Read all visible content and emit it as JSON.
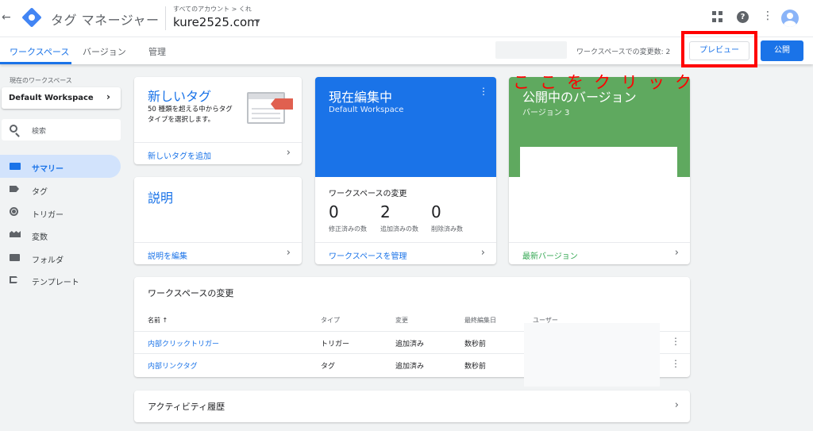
{
  "header": {
    "back_icon": "←",
    "app_title": "タグ マネージャー",
    "account_breadcrumb": "すべてのアカウント > くれ",
    "container_name": "kure2525.com",
    "caret": "▾",
    "help_glyph": "?",
    "more_glyph": "⋮"
  },
  "tabs": {
    "workspace": "ワークスペース",
    "versions": "バージョン",
    "admin": "管理"
  },
  "toolbar": {
    "changes_count": "ワークスペースでの変更数: 2",
    "preview_label": "プレビュー",
    "publish_label": "公開"
  },
  "annotation": {
    "click_here": "ここをクリック",
    "highlight_color": "#ff0000"
  },
  "sidebar": {
    "current_ws_label": "現在のワークスペース",
    "workspace_name": "Default Workspace",
    "workspace_chevron": "›",
    "search_placeholder": "検索",
    "items": [
      {
        "label": "サマリー",
        "icon": "summary-icon",
        "active": true
      },
      {
        "label": "タグ",
        "icon": "tag-icon"
      },
      {
        "label": "トリガー",
        "icon": "trigger-icon"
      },
      {
        "label": "変数",
        "icon": "variables-icon"
      },
      {
        "label": "フォルダ",
        "icon": "folder-icon"
      },
      {
        "label": "テンプレート",
        "icon": "template-icon"
      }
    ]
  },
  "cards": {
    "new_tag": {
      "title": "新しいタグ",
      "description": "50 種類を超える中からタグタイプを選択します。",
      "link": "新しいタグを追加"
    },
    "description": {
      "title": "説明",
      "link": "説明を編集"
    },
    "editing": {
      "title": "現在編集中",
      "subtitle": "Default Workspace",
      "dots": "⋮",
      "changes_title": "ワークスペースの変更",
      "modified": "0",
      "modified_label": "修正済みの数",
      "added": "2",
      "added_label": "追加済みの数",
      "deleted": "0",
      "deleted_label": "削除済み数",
      "link": "ワークスペースを管理"
    },
    "live": {
      "title": "公開中のバージョン",
      "subtitle": "バージョン 3",
      "link": "最新バージョン"
    },
    "chevron": "›"
  },
  "changes_table": {
    "title": "ワークスペースの変更",
    "columns": [
      "名前 ↑",
      "タイプ",
      "変更",
      "最終編集日",
      "ユーザー"
    ],
    "rows": [
      {
        "name": "内部クリックトリガー",
        "type": "トリガー",
        "change": "追加済み",
        "edited": "数秒前"
      },
      {
        "name": "内部リンクタグ",
        "type": "タグ",
        "change": "追加済み",
        "edited": "数秒前"
      }
    ],
    "row_more": "⋮"
  },
  "activity": {
    "title": "アクティビティ履歴"
  }
}
